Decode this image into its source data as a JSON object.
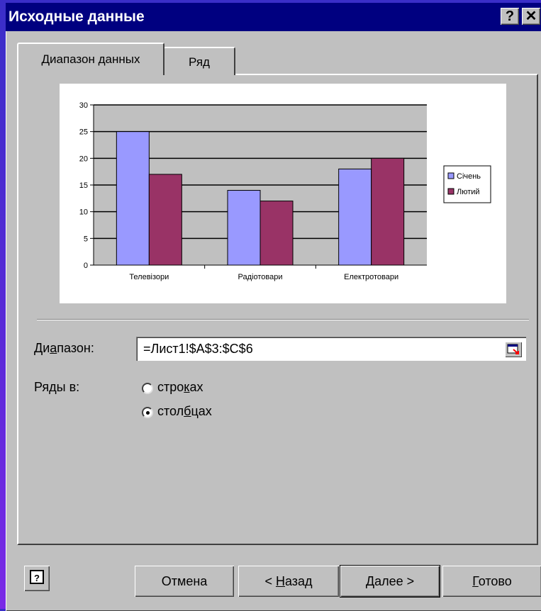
{
  "window": {
    "title": "Исходные данные",
    "help_glyph": "?",
    "close_glyph": "✕"
  },
  "tabs": [
    {
      "label": "Диапазон данных",
      "active": true
    },
    {
      "label": "Ряд",
      "active": false
    }
  ],
  "chart_data": {
    "type": "bar",
    "categories": [
      "Телевізори",
      "Радіотовари",
      "Електротовари"
    ],
    "series": [
      {
        "name": "Січень",
        "values": [
          25,
          14,
          18
        ],
        "color": "#9999ff"
      },
      {
        "name": "Лютий",
        "values": [
          17,
          12,
          20
        ],
        "color": "#993366"
      }
    ],
    "ylim": [
      0,
      30
    ],
    "yticks": [
      0,
      5,
      10,
      15,
      20,
      25,
      30
    ],
    "grid": true,
    "legend": "right",
    "plot_background": "#c0c0c0"
  },
  "range": {
    "label_before": "Ди",
    "label_accel": "а",
    "label_after": "пазон:",
    "value": "=Лист1!$A$3:$C$6"
  },
  "series_in": {
    "label": "Ряды в:",
    "options": [
      {
        "before": "стро",
        "accel": "к",
        "after": "ах",
        "selected": false
      },
      {
        "before": "стол",
        "accel": "б",
        "after": "цах",
        "selected": true
      }
    ]
  },
  "buttons": {
    "help": "?",
    "cancel": "Отмена",
    "back_before": "< ",
    "back_accel": "Н",
    "back_after": "азад",
    "next": "Далее >",
    "finish_accel": "Г",
    "finish_after": "отово"
  },
  "colors": {
    "title_bar": "#000080",
    "dialog": "#c0c0c0",
    "series_1": "#9999ff",
    "series_2": "#993366"
  }
}
